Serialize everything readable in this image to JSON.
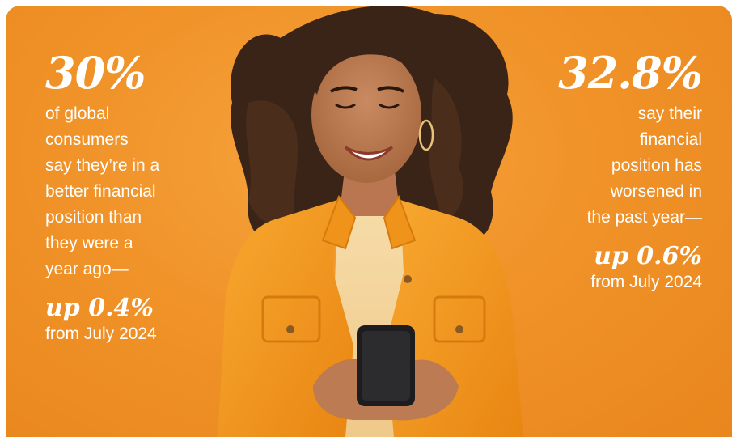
{
  "colors": {
    "background": "#f09329",
    "text": "#ffffff",
    "jacket": "#f29a1f",
    "hair": "#3a2417"
  },
  "stat_left": {
    "value": "30%",
    "description_lines": [
      "of global",
      "consumers",
      "say they’re in a",
      "better financial",
      "position than",
      "they were a",
      "year ago—"
    ],
    "change": "up 0.4%",
    "since": "from July 2024"
  },
  "stat_right": {
    "value": "32.8%",
    "description_lines": [
      "say their",
      "financial",
      "position has",
      "worsened in",
      "the past year—"
    ],
    "change": "up 0.6%",
    "since": "from July 2024"
  }
}
